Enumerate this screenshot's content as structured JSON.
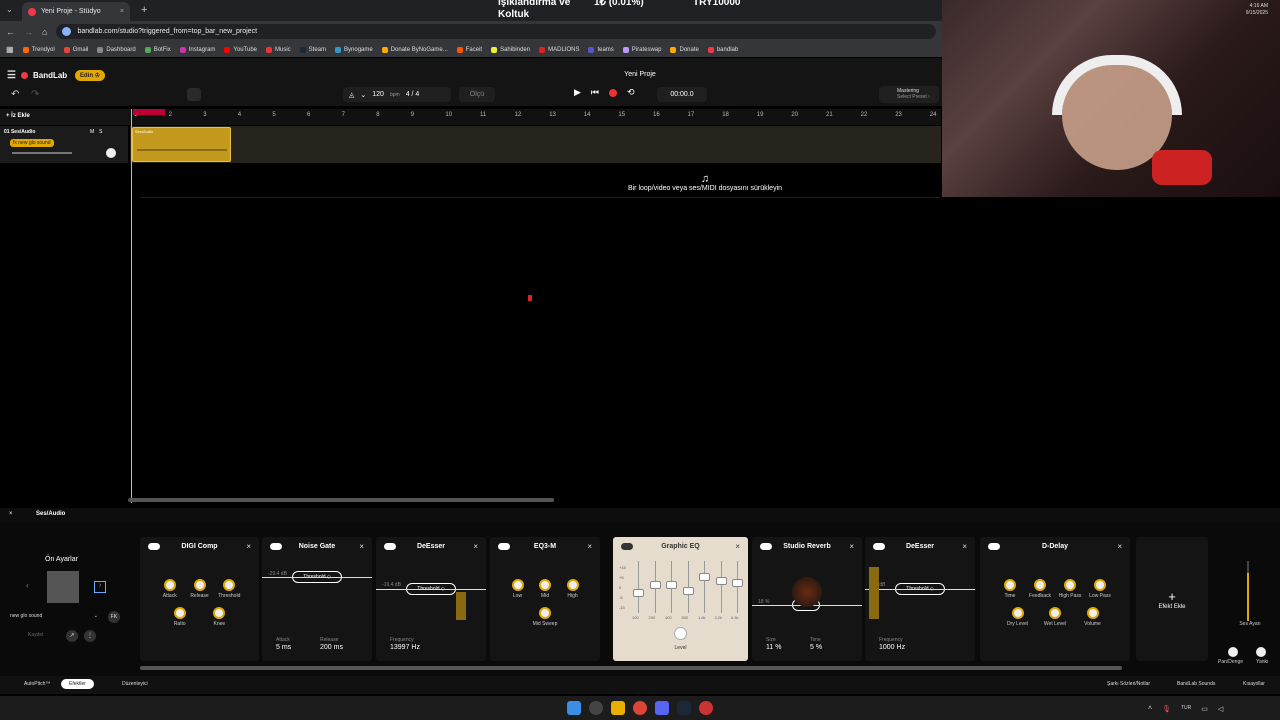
{
  "browser": {
    "tab_title": "Yeni Proje - Stüdyo",
    "tab_close": "×",
    "new_tab": "+",
    "url": "bandlab.com/studio?triggered_from=top_bar_new_project",
    "bookmarks": [
      "Trendyol",
      "Gmail",
      "Dashboard",
      "BotFix",
      "Instagram",
      "YouTube",
      "Music",
      "Steam",
      "Bynogame",
      "Donate ByNoGame...",
      "Faceit",
      "Sahibinden",
      "MADLIONS",
      "teams",
      "Pirateswap",
      "Donate",
      "bandlab"
    ],
    "bookmark_colors": [
      "#f60",
      "#ea4335",
      "#888",
      "#5a5",
      "#c3a",
      "#f00",
      "#e33",
      "#1b2838",
      "#39c",
      "#fa0",
      "#f50",
      "#ee3",
      "#d22",
      "#55c",
      "#b9f",
      "#fa0",
      "#f03a47"
    ]
  },
  "ticker": {
    "line1": "Işıklandırma ve",
    "line2": "Koltuk",
    "pct": "1₺ (0.01%)",
    "amount": "TRY10000"
  },
  "header": {
    "logo": "BandLab",
    "edin": "Edin ♔",
    "project_title": "Yeni Proje",
    "bpm": "120",
    "bpm_unit": "bpm",
    "signature": "4 / 4",
    "olcu": "Ölçü",
    "time": "00:00.0",
    "mastering": "Mastering",
    "mastering_sub": "Select Preset ›"
  },
  "tracks": {
    "add_track": "+ İz Ekle",
    "track1": {
      "name": "01  Ses/Audio",
      "fx": "fx  new glo sound",
      "mute": "M",
      "solo": "S",
      "region": "Ses/Audio"
    }
  },
  "timeline": {
    "bars": [
      "1",
      "2",
      "3",
      "4",
      "5",
      "6",
      "7",
      "8",
      "9",
      "10",
      "11",
      "12",
      "13",
      "14",
      "15",
      "16",
      "17",
      "18",
      "19",
      "20",
      "21",
      "22",
      "23",
      "24"
    ]
  },
  "drop_hint": "Bir loop/video veya ses/MIDI dosyasını sürükleyin",
  "fx_panel": {
    "track": "Ses/Audio",
    "presets_title": "Ön Ayarlar",
    "preset_name": "new glo sound",
    "kaydet": "Kaydet",
    "fk": "FK",
    "add_effect": "Efekt Ekle",
    "close": "×",
    "effects": [
      {
        "name": "DIGI Comp",
        "knobs": [
          "Attack",
          "Release",
          "Threshold",
          "Ratio",
          "Knee"
        ]
      },
      {
        "name": "Noise Gate",
        "pill": "Threshold ◇",
        "db": "-29.4 dB",
        "v1_label": "Attack",
        "v1": "5 ms",
        "v2_label": "Release",
        "v2": "200 ms"
      },
      {
        "name": "DeEsser",
        "pill": "Threshold ◇",
        "db": "-19.4 dB",
        "v1_label": "Frequency",
        "v1": "13997 Hz"
      },
      {
        "name": "EQ3-M",
        "knobs": [
          "Low",
          "Mid",
          "High",
          "Mid Sweep"
        ]
      },
      {
        "name": "Graphic EQ",
        "level": "Level",
        "bands": [
          "100",
          "200",
          "400",
          "800",
          "1.6k",
          "3.2k",
          "6.4k"
        ],
        "scale": [
          "+15",
          "+5",
          "0",
          "-5",
          "-15"
        ]
      },
      {
        "name": "Studio Reverb",
        "pill": "Mix ◇",
        "pct": "18 %",
        "v1_label": "Size",
        "v1": "11 %",
        "v2_label": "Tone",
        "v2": "5 %"
      },
      {
        "name": "DeEsser",
        "pill": "Threshold ◇",
        "db": "0.0 dB",
        "v1_label": "Frequency",
        "v1": "1000 Hz"
      },
      {
        "name": "D-Delay",
        "knobs": [
          "Time",
          "Feedback",
          "High Pass",
          "Low Pass",
          "Dry Level",
          "Wet Level",
          "Volume"
        ]
      }
    ],
    "volume_label": "Ses Ayarı",
    "pan_label": "Pan/Denge",
    "yanki_label": "Yankı"
  },
  "bottom_bar": {
    "autopitch": "AutoPitch™",
    "efektler": "Efektler",
    "duzenleyici": "Düzenleyici",
    "lyrics": "Şarkı Sözleri/Notlar",
    "sounds": "BandLab Sounds",
    "kisayollar": "Kısayollar"
  },
  "taskbar": {
    "lang": "TUR",
    "time": "4:16 AM",
    "date": "9/15/2025"
  },
  "colors": {
    "accent": "#e0a800",
    "brand": "#f03a47",
    "record": "#e33"
  }
}
